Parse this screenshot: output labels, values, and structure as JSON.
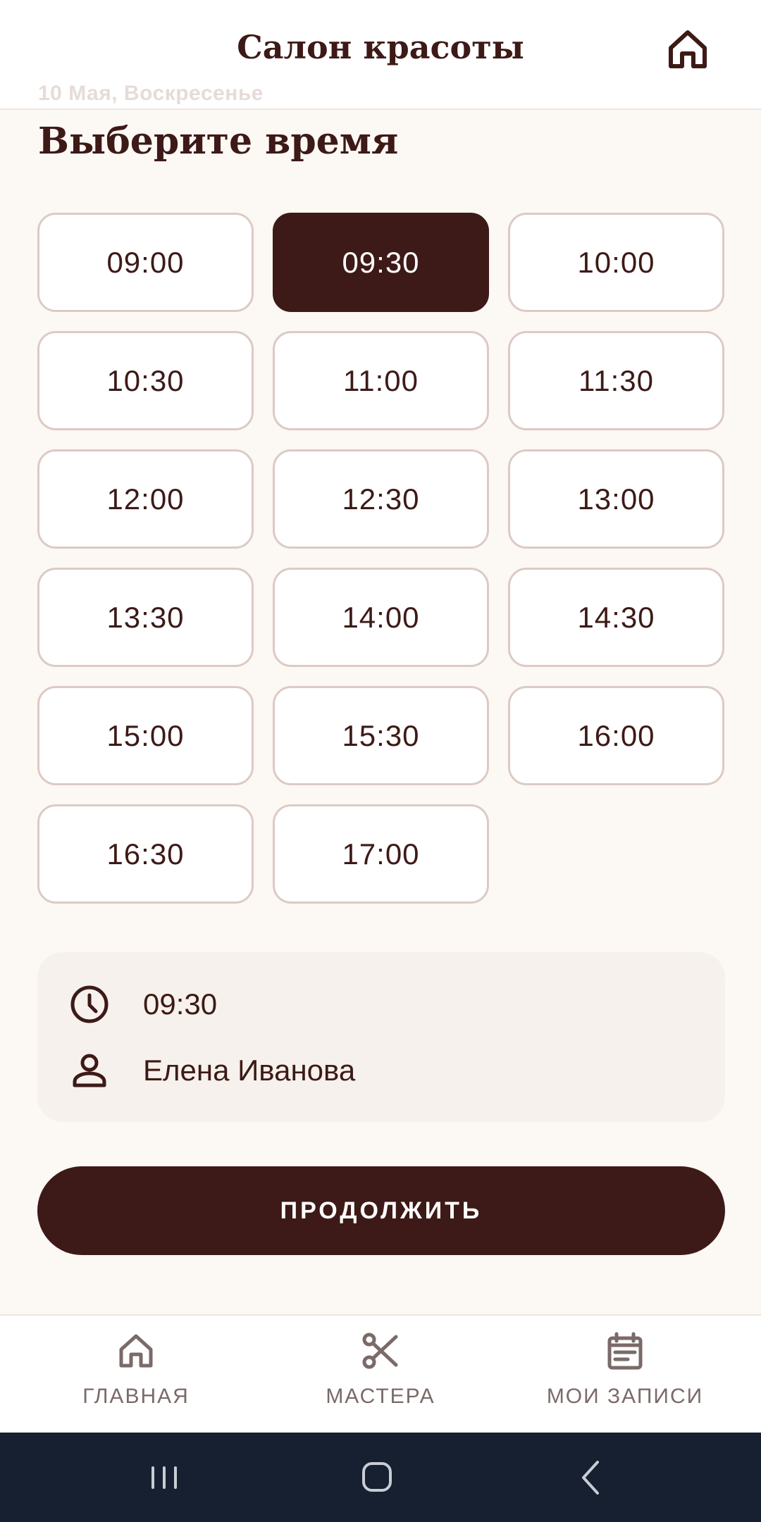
{
  "header": {
    "title": "Салон красоты",
    "date": "10 Мая, Воскресенье"
  },
  "page": {
    "heading": "Выберите время"
  },
  "slots": [
    {
      "time": "09:00",
      "selected": false
    },
    {
      "time": "09:30",
      "selected": true
    },
    {
      "time": "10:00",
      "selected": false
    },
    {
      "time": "10:30",
      "selected": false
    },
    {
      "time": "11:00",
      "selected": false
    },
    {
      "time": "11:30",
      "selected": false
    },
    {
      "time": "12:00",
      "selected": false
    },
    {
      "time": "12:30",
      "selected": false
    },
    {
      "time": "13:00",
      "selected": false
    },
    {
      "time": "13:30",
      "selected": false
    },
    {
      "time": "14:00",
      "selected": false
    },
    {
      "time": "14:30",
      "selected": false
    },
    {
      "time": "15:00",
      "selected": false
    },
    {
      "time": "15:30",
      "selected": false
    },
    {
      "time": "16:00",
      "selected": false
    },
    {
      "time": "16:30",
      "selected": false
    },
    {
      "time": "17:00",
      "selected": false
    }
  ],
  "summary": {
    "time": "09:30",
    "master": "Елена Иванова"
  },
  "actions": {
    "continue_label": "ПРОДОЛЖИТЬ"
  },
  "nav": {
    "items": [
      {
        "label": "ГЛАВНАЯ",
        "icon": "home-icon"
      },
      {
        "label": "МАСТЕРА",
        "icon": "scissors-icon"
      },
      {
        "label": "МОИ ЗАПИСИ",
        "icon": "calendar-icon"
      }
    ]
  },
  "colors": {
    "primary": "#3d1a17",
    "background": "#fcf8f4",
    "slot_border": "#dccac5",
    "nav_label": "#7a6a68",
    "system_bar": "#162030"
  }
}
